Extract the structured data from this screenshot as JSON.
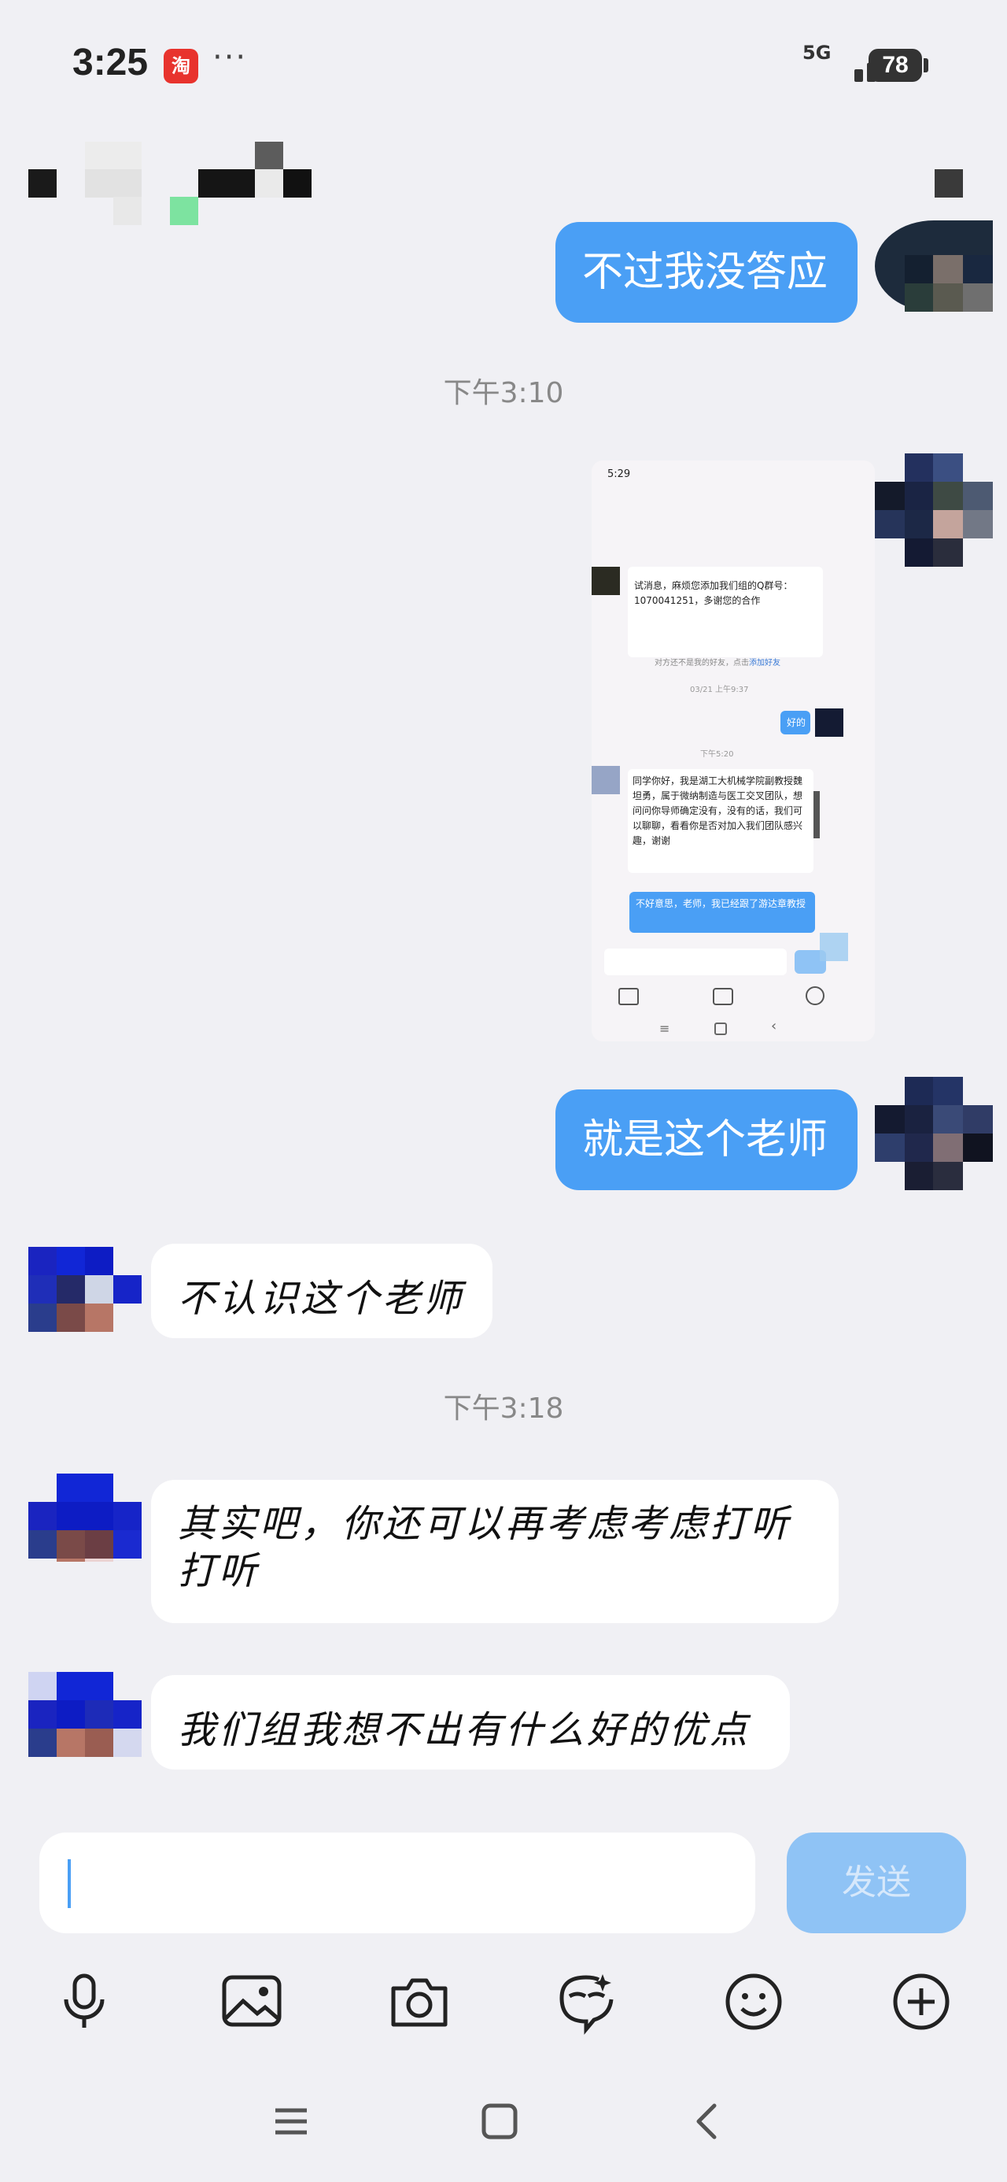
{
  "status_bar": {
    "time": "3:25",
    "app_badge": "淘",
    "more": "···",
    "network": "5G",
    "battery": "78"
  },
  "messages": [
    {
      "side": "out",
      "text": "不过我没答应"
    },
    {
      "type": "time",
      "text": "下午3:10"
    },
    {
      "side": "out",
      "type": "image"
    },
    {
      "side": "out",
      "text": "就是这个老师"
    },
    {
      "side": "in",
      "text": "不认识这个老师"
    },
    {
      "type": "time",
      "text": "下午3:18"
    },
    {
      "side": "in",
      "text": "其实吧，你还可以再考虑考虑打听打听"
    },
    {
      "side": "in",
      "text": "我们组我想不出有什么好的优点"
    }
  ],
  "embedded_screenshot": {
    "time": "5:29",
    "msg1": "试消息，麻烦您添加我们组的Q群号：1070041251，多谢您的合作",
    "group_number": "1070041251",
    "notice": "对方还不是我的好友，点击",
    "notice_link": "添加好友",
    "date1": "03/21 上午9:37",
    "reply_ok": "好的",
    "date2": "下午5:20",
    "msg2": "同学你好，我是湖工大机械学院副教授魏坦勇，属于微纳制造与医工交叉团队，想问问你导师确定没有，没有的话，我们可以聊聊，看看你是否对加入我们团队感兴趣，谢谢",
    "reply2": "不好意思，老师，我已经跟了游达章教授"
  },
  "composer": {
    "input_value": "",
    "send_label": "发送"
  },
  "toolbar": [
    "microphone-icon",
    "image-icon",
    "camera-icon",
    "sticker-icon",
    "emoji-icon",
    "plus-icon"
  ],
  "colors": {
    "outgoing_bubble": "#4a9ff5",
    "incoming_bubble": "#ffffff",
    "background": "#f0f0f4",
    "send_button": "#8fc3f5"
  }
}
